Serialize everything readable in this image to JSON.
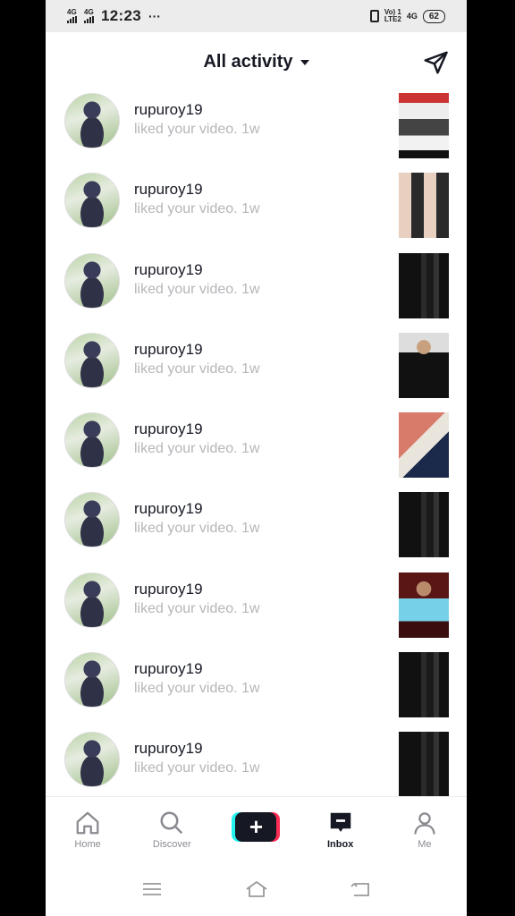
{
  "status": {
    "net1": "4G",
    "net2": "4G",
    "time": "12:23",
    "dots": "···",
    "volte_top": "Vo) 1",
    "volte_bottom": "LTE2",
    "net3": "4G",
    "battery": "62"
  },
  "header": {
    "title": "All activity"
  },
  "activities": [
    {
      "username": "rupuroy19",
      "action": "liked your video. 1w",
      "thumb": "photo1"
    },
    {
      "username": "rupuroy19",
      "action": "liked your video. 1w",
      "thumb": "photo2"
    },
    {
      "username": "rupuroy19",
      "action": "liked your video. 1w",
      "thumb": "dark"
    },
    {
      "username": "rupuroy19",
      "action": "liked your video. 1w",
      "thumb": "man"
    },
    {
      "username": "rupuroy19",
      "action": "liked your video. 1w",
      "thumb": "girl"
    },
    {
      "username": "rupuroy19",
      "action": "liked your video. 1w",
      "thumb": "dark"
    },
    {
      "username": "rupuroy19",
      "action": "liked your video. 1w",
      "thumb": "boy"
    },
    {
      "username": "rupuroy19",
      "action": "liked your video. 1w",
      "thumb": "dark"
    },
    {
      "username": "rupuroy19",
      "action": "liked your video. 1w",
      "thumb": "dark"
    }
  ],
  "tabs": {
    "home": "Home",
    "discover": "Discover",
    "create": "+",
    "inbox": "Inbox",
    "me": "Me"
  },
  "icons": [
    "send-icon",
    "home-icon",
    "search-icon",
    "plus-icon",
    "inbox-icon",
    "profile-icon",
    "menu-icon",
    "home-nav-icon",
    "back-icon"
  ],
  "colors": {
    "text": "#161823",
    "muted": "#b5b6ba",
    "cyan": "#25f4ee",
    "red": "#fe2c55"
  }
}
